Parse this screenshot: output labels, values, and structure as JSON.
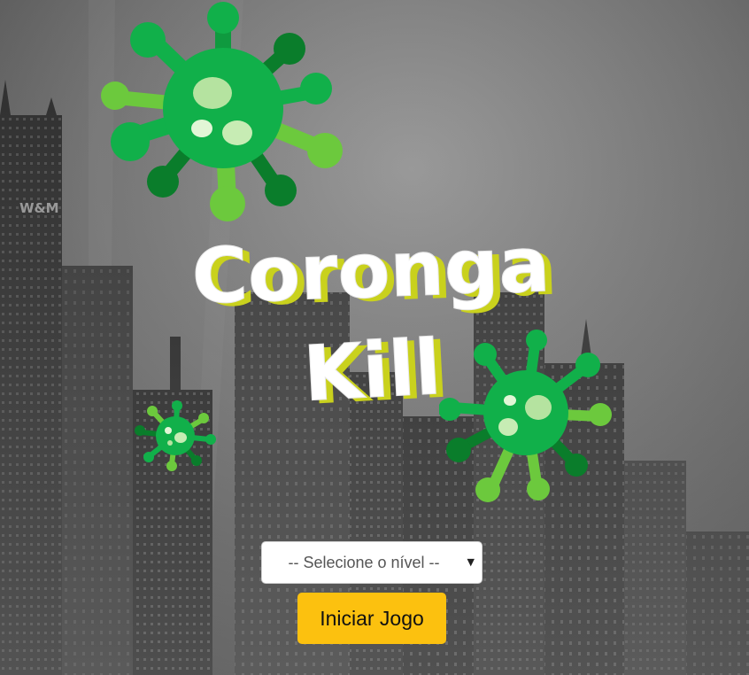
{
  "title": {
    "line1": "Coronga",
    "line2": "Kill"
  },
  "level_select": {
    "placeholder": "-- Selecione o nível --"
  },
  "start_button": {
    "label": "Iniciar Jogo"
  },
  "colors": {
    "background_sky": "#6b6b6b",
    "building_dark": "#2a2a2a",
    "virus_green": "#11b04a",
    "virus_light_green": "#6cc93d",
    "virus_dark_green": "#0a7d2b",
    "title_text": "#ffffff",
    "title_shadow": "#c9d11d",
    "start_button_bg": "#fcc10f"
  },
  "icons": {
    "large_virus": "coronavirus-icon",
    "medium_virus": "coronavirus-icon",
    "small_virus": "coronavirus-icon",
    "select_arrow": "caret-down-icon"
  }
}
